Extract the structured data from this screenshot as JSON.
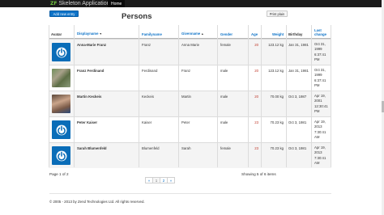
{
  "navbar": {
    "brand_mark": "ZF",
    "brand_name": "Skeleton Application",
    "home": "Home"
  },
  "toolbar": {
    "add_label": "Add new entry",
    "print_label": "Print plain"
  },
  "page": {
    "title": "Persons"
  },
  "table": {
    "headers": {
      "avatar": "Avatar",
      "displayname": "Displayname",
      "familyname": "Familyname",
      "givenname": "Givenname",
      "gender": "Gender",
      "age": "Age",
      "weight": "Weight",
      "birthday": "Birthday",
      "last_change_1": "Last",
      "last_change_2": "change"
    },
    "rows": [
      {
        "avatar": "power-icon",
        "displayname": "Anna-Marie Franz",
        "familyname": "Franz",
        "givenname": "Anna Marie",
        "gender": "female",
        "age": "20",
        "weight": "123.12 kg",
        "birthday": "Jan 31, 1981",
        "updated": [
          "Oct 31,",
          "1999",
          "6:37:41",
          "PM"
        ]
      },
      {
        "avatar": "photo",
        "displayname": "Franz Ferdinand",
        "familyname": "Ferdinand",
        "givenname": "Franz",
        "gender": "male",
        "age": "20",
        "weight": "123.12 kg",
        "birthday": "Jan 31, 1981",
        "updated": [
          "Oct 31,",
          "1999",
          "6:37:41",
          "PM"
        ]
      },
      {
        "avatar": "photo",
        "displayname": "Martin Keckeis",
        "familyname": "Keckeis",
        "givenname": "Martin",
        "gender": "male",
        "age": "20",
        "weight": "70.00 kg",
        "birthday": "Oct 3, 1987",
        "updated": [
          "Apr 19,",
          "2001",
          "12:30:41",
          "PM"
        ]
      },
      {
        "avatar": "power-icon",
        "displayname": "Peter Kaiser",
        "familyname": "Kaiser",
        "givenname": "Peter",
        "gender": "male",
        "age": "23",
        "weight": "70.23 kg",
        "birthday": "Oct 3, 1981",
        "updated": [
          "Apr 19,",
          "2013",
          "7:30:41",
          "AM"
        ]
      },
      {
        "avatar": "power-icon",
        "displayname": "Sarah Blumenfeld",
        "familyname": "Blumenfeld",
        "givenname": "Sarah",
        "gender": "female",
        "age": "23",
        "weight": "70.23 kg",
        "birthday": "Oct 3, 1981",
        "updated": [
          "Apr 19,",
          "2013",
          "7:30:41",
          "AM"
        ]
      }
    ]
  },
  "pager": {
    "page_info": "Page 1 of 2",
    "showing": "Showing 5 of 6 items",
    "prev": "«",
    "pages": [
      "1",
      "2"
    ],
    "next": "»"
  },
  "footer": {
    "copyright": "© 2005 - 2013 by Zend Technologies Ltd. All rights reserved."
  },
  "colors": {
    "accent": "#0e73c8",
    "age_text": "#c0392b",
    "navbar": "#1b1b1b"
  }
}
